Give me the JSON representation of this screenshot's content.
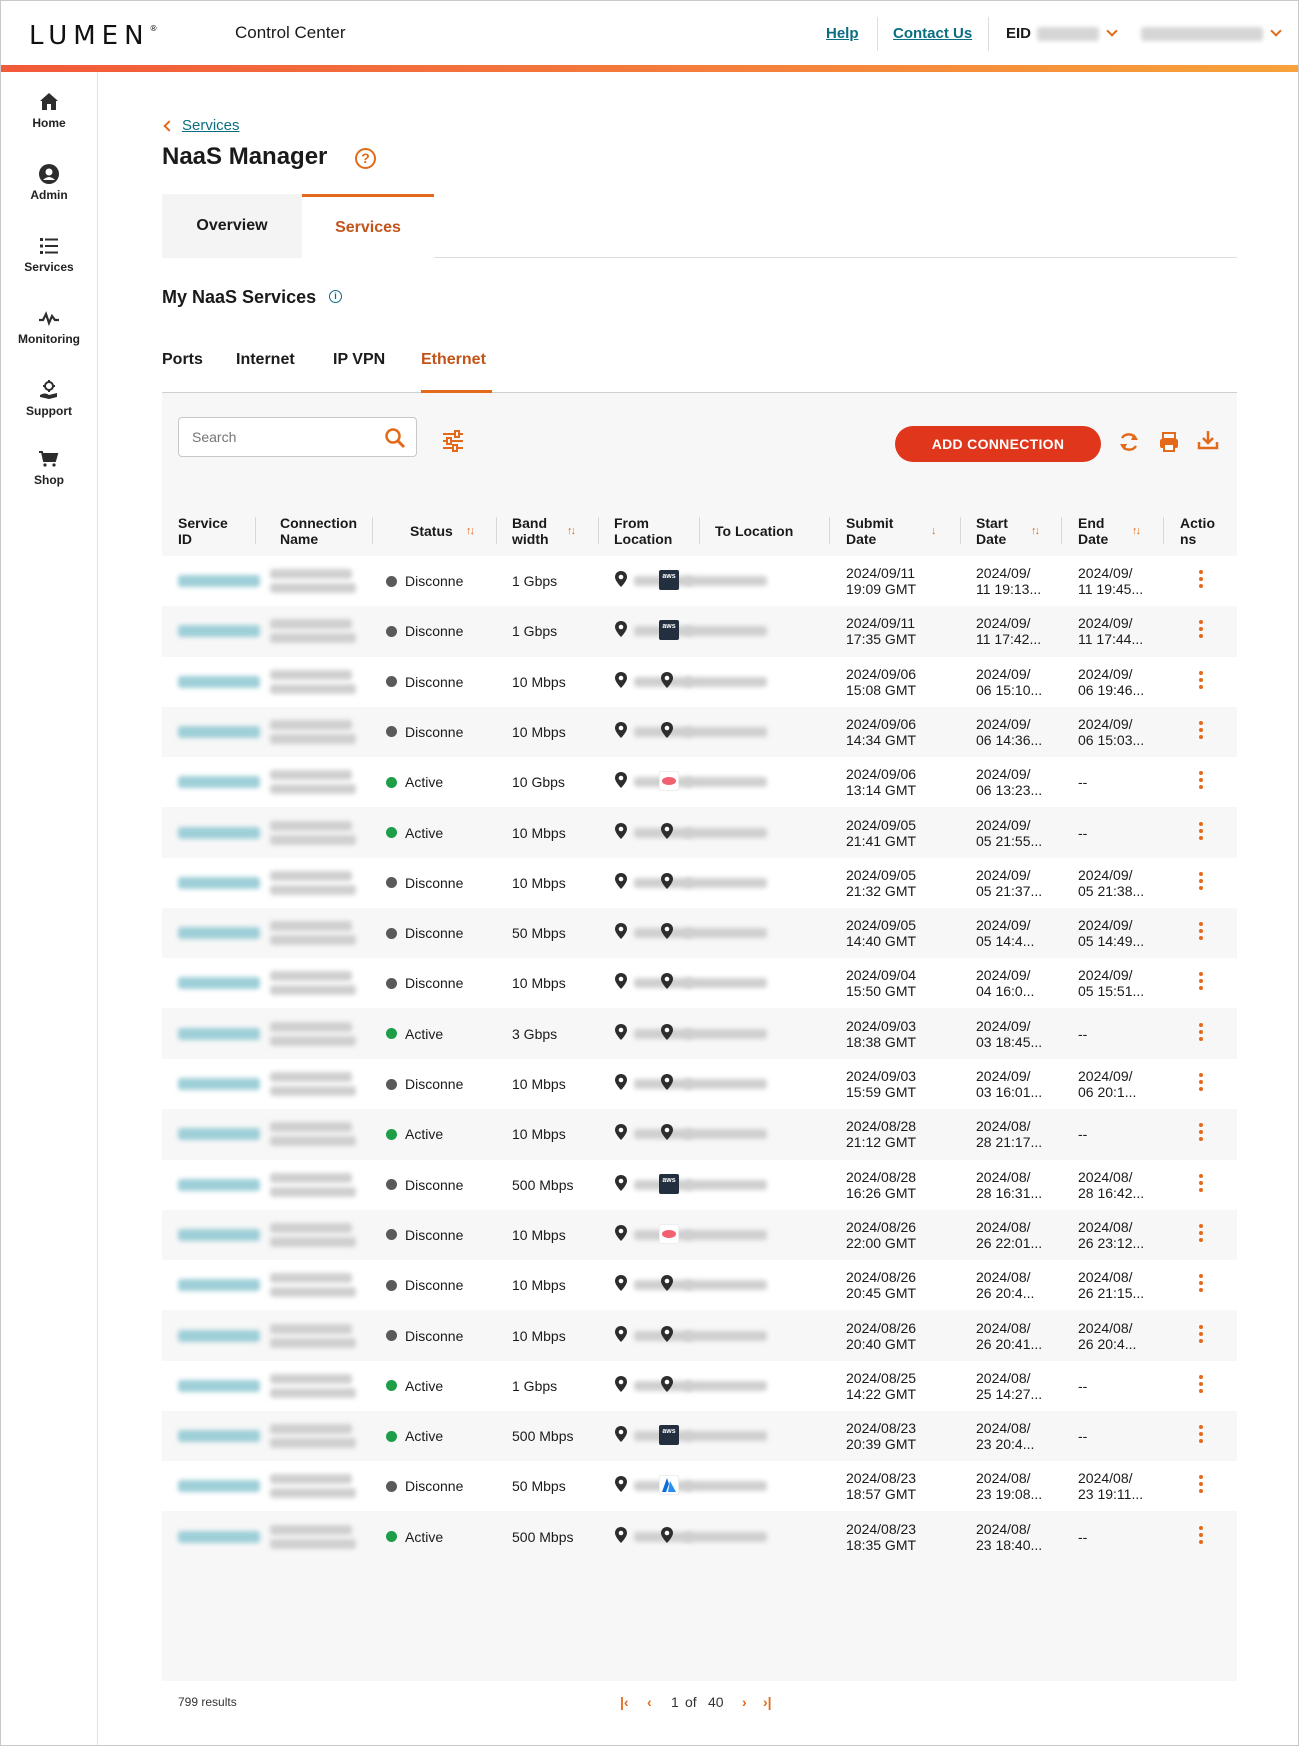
{
  "header": {
    "brand": "LUMEN",
    "brand_mark": "®",
    "app_title": "Control Center",
    "help": "Help",
    "contact": "Contact Us",
    "eid_label": "EID"
  },
  "sidebar": {
    "items": [
      {
        "label": "Home",
        "icon": "home-icon"
      },
      {
        "label": "Admin",
        "icon": "user-circle-icon"
      },
      {
        "label": "Services",
        "icon": "list-icon"
      },
      {
        "label": "Monitoring",
        "icon": "pulse-icon"
      },
      {
        "label": "Support",
        "icon": "support-icon"
      },
      {
        "label": "Shop",
        "icon": "cart-icon"
      }
    ]
  },
  "breadcrumb": {
    "label": "Services"
  },
  "page": {
    "title": "NaaS Manager",
    "help_icon": "?",
    "tabs": [
      {
        "label": "Overview"
      },
      {
        "label": "Services",
        "active": true
      }
    ],
    "section_title": "My NaaS Services",
    "info_icon": "i",
    "subtabs": [
      {
        "label": "Ports"
      },
      {
        "label": "Internet"
      },
      {
        "label": "IP VPN"
      },
      {
        "label": "Ethernet",
        "active": true
      }
    ]
  },
  "toolbar": {
    "search_placeholder": "Search",
    "add_connection": "ADD CONNECTION"
  },
  "table": {
    "headers": {
      "service_id": [
        "Service",
        "ID"
      ],
      "connection_name": [
        "Connection",
        "Name"
      ],
      "status": "Status",
      "bandwidth": [
        "Band",
        "width"
      ],
      "from_location": [
        "From",
        "Location"
      ],
      "to_location": "To Location",
      "submit_date": [
        "Submit",
        "Date"
      ],
      "start_date": [
        "Start",
        "Date"
      ],
      "end_date": [
        "End",
        "Date"
      ],
      "actions": [
        "Actio",
        "ns"
      ]
    },
    "rows": [
      {
        "status": "Disconne",
        "bw": "1 Gbps",
        "to": "aws",
        "submit": [
          "2024/09/11",
          "19:09 GMT"
        ],
        "start": [
          "2024/09/",
          "11 19:13..."
        ],
        "end": [
          "2024/09/",
          "11 19:45..."
        ]
      },
      {
        "status": "Disconne",
        "bw": "1 Gbps",
        "to": "aws",
        "submit": [
          "2024/09/11",
          "17:35 GMT"
        ],
        "start": [
          "2024/09/",
          "11 17:42..."
        ],
        "end": [
          "2024/09/",
          "11 17:44..."
        ]
      },
      {
        "status": "Disconne",
        "bw": "10 Mbps",
        "to": "pin",
        "submit": [
          "2024/09/06",
          "15:08 GMT"
        ],
        "start": [
          "2024/09/",
          "06 15:10..."
        ],
        "end": [
          "2024/09/",
          "06 19:46..."
        ]
      },
      {
        "status": "Disconne",
        "bw": "10 Mbps",
        "to": "pin",
        "submit": [
          "2024/09/06",
          "14:34 GMT"
        ],
        "start": [
          "2024/09/",
          "06 14:36..."
        ],
        "end": [
          "2024/09/",
          "06 15:03..."
        ]
      },
      {
        "status": "Active",
        "bw": "10 Gbps",
        "to": "oracle",
        "submit": [
          "2024/09/06",
          "13:14 GMT"
        ],
        "start": [
          "2024/09/",
          "06 13:23..."
        ],
        "end": [
          "--",
          ""
        ]
      },
      {
        "status": "Active",
        "bw": "10 Mbps",
        "to": "pin",
        "submit": [
          "2024/09/05",
          "21:41 GMT"
        ],
        "start": [
          "2024/09/",
          "05 21:55..."
        ],
        "end": [
          "--",
          ""
        ]
      },
      {
        "status": "Disconne",
        "bw": "10 Mbps",
        "to": "pin",
        "submit": [
          "2024/09/05",
          "21:32 GMT"
        ],
        "start": [
          "2024/09/",
          "05 21:37..."
        ],
        "end": [
          "2024/09/",
          "05 21:38..."
        ]
      },
      {
        "status": "Disconne",
        "bw": "50 Mbps",
        "to": "pin",
        "submit": [
          "2024/09/05",
          "14:40 GMT"
        ],
        "start": [
          "2024/09/",
          "05 14:4..."
        ],
        "end": [
          "2024/09/",
          "05 14:49..."
        ]
      },
      {
        "status": "Disconne",
        "bw": "10 Mbps",
        "to": "pin",
        "submit": [
          "2024/09/04",
          "15:50 GMT"
        ],
        "start": [
          "2024/09/",
          "04 16:0..."
        ],
        "end": [
          "2024/09/",
          "05 15:51..."
        ]
      },
      {
        "status": "Active",
        "bw": "3 Gbps",
        "to": "pin",
        "submit": [
          "2024/09/03",
          "18:38 GMT"
        ],
        "start": [
          "2024/09/",
          "03 18:45..."
        ],
        "end": [
          "--",
          ""
        ]
      },
      {
        "status": "Disconne",
        "bw": "10 Mbps",
        "to": "pin",
        "submit": [
          "2024/09/03",
          "15:59 GMT"
        ],
        "start": [
          "2024/09/",
          "03 16:01..."
        ],
        "end": [
          "2024/09/",
          "06 20:1..."
        ]
      },
      {
        "status": "Active",
        "bw": "10 Mbps",
        "to": "pin",
        "submit": [
          "2024/08/28",
          "21:12 GMT"
        ],
        "start": [
          "2024/08/",
          "28 21:17..."
        ],
        "end": [
          "--",
          ""
        ]
      },
      {
        "status": "Disconne",
        "bw": "500 Mbps",
        "to": "aws",
        "submit": [
          "2024/08/28",
          "16:26 GMT"
        ],
        "start": [
          "2024/08/",
          "28 16:31..."
        ],
        "end": [
          "2024/08/",
          "28 16:42..."
        ]
      },
      {
        "status": "Disconne",
        "bw": "10 Mbps",
        "to": "oracle",
        "submit": [
          "2024/08/26",
          "22:00 GMT"
        ],
        "start": [
          "2024/08/",
          "26 22:01..."
        ],
        "end": [
          "2024/08/",
          "26 23:12..."
        ]
      },
      {
        "status": "Disconne",
        "bw": "10 Mbps",
        "to": "pin",
        "submit": [
          "2024/08/26",
          "20:45 GMT"
        ],
        "start": [
          "2024/08/",
          "26 20:4..."
        ],
        "end": [
          "2024/08/",
          "26 21:15..."
        ]
      },
      {
        "status": "Disconne",
        "bw": "10 Mbps",
        "to": "pin",
        "submit": [
          "2024/08/26",
          "20:40 GMT"
        ],
        "start": [
          "2024/08/",
          "26 20:41..."
        ],
        "end": [
          "2024/08/",
          "26 20:4..."
        ]
      },
      {
        "status": "Active",
        "bw": "1 Gbps",
        "to": "pin",
        "submit": [
          "2024/08/25",
          "14:22 GMT"
        ],
        "start": [
          "2024/08/",
          "25 14:27..."
        ],
        "end": [
          "--",
          ""
        ]
      },
      {
        "status": "Active",
        "bw": "500 Mbps",
        "to": "aws",
        "submit": [
          "2024/08/23",
          "20:39 GMT"
        ],
        "start": [
          "2024/08/",
          "23 20:4..."
        ],
        "end": [
          "--",
          ""
        ]
      },
      {
        "status": "Disconne",
        "bw": "50 Mbps",
        "to": "azure",
        "submit": [
          "2024/08/23",
          "18:57 GMT"
        ],
        "start": [
          "2024/08/",
          "23 19:08..."
        ],
        "end": [
          "2024/08/",
          "23 19:11..."
        ]
      },
      {
        "status": "Active",
        "bw": "500 Mbps",
        "to": "pin",
        "submit": [
          "2024/08/23",
          "18:35 GMT"
        ],
        "start": [
          "2024/08/",
          "23 18:40..."
        ],
        "end": [
          "--",
          ""
        ]
      }
    ]
  },
  "footer": {
    "results": "799 results",
    "page_current": "1",
    "page_of": "of",
    "page_total": "40"
  },
  "colors": {
    "accent": "#e26a1a",
    "primary_button": "#e0361c",
    "link": "#0b6e80",
    "active_status": "#1f9e4a",
    "inactive_status": "#5a5a5a"
  }
}
